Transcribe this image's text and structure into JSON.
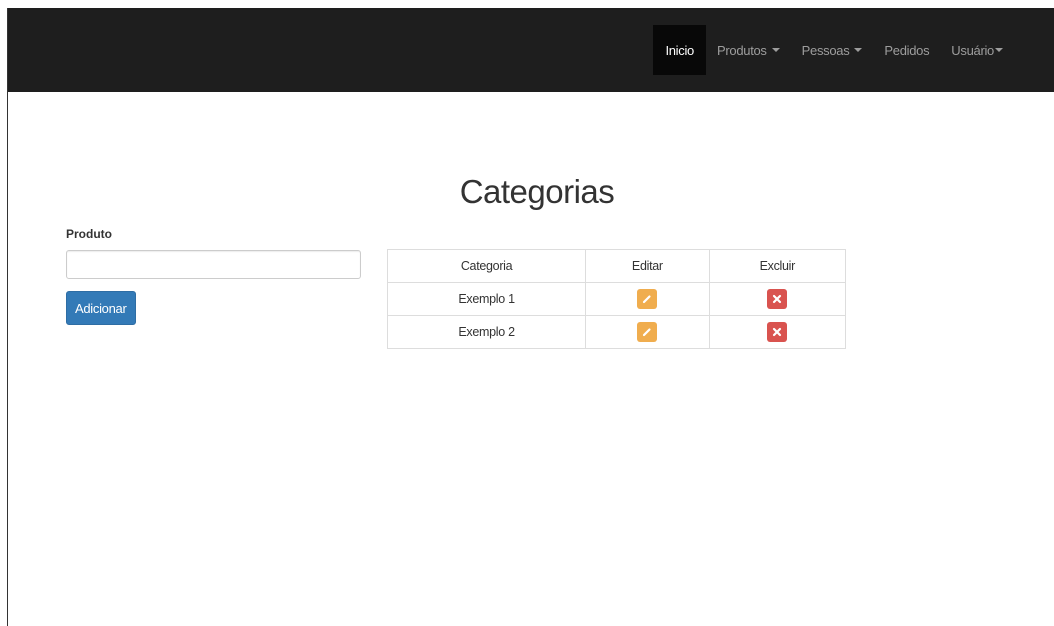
{
  "navbar": {
    "items": [
      {
        "label": "Inicio",
        "active": true
      },
      {
        "label": "Produtos",
        "dropdown": true
      },
      {
        "label": "Pessoas",
        "dropdown": true
      },
      {
        "label": "Pedidos"
      },
      {
        "label": "Usuário",
        "dropdown": true
      }
    ],
    "background_color": "#1e1e1e",
    "active_color": "#080808"
  },
  "page": {
    "title": "Categorias"
  },
  "form": {
    "label": "Produto",
    "input_value": "",
    "input_placeholder": "",
    "add_label": "Adicionar"
  },
  "table": {
    "headers": [
      "Categoria",
      "Editar",
      "Excluir"
    ],
    "rows": [
      {
        "categoria": "Exemplo 1"
      },
      {
        "categoria": "Exemplo 2"
      }
    ]
  },
  "icons": {
    "edit": "pencil-icon",
    "delete": "remove-icon"
  },
  "colors": {
    "primary": "#337ab7",
    "warning": "#f0ad4e",
    "danger": "#d9534f"
  }
}
